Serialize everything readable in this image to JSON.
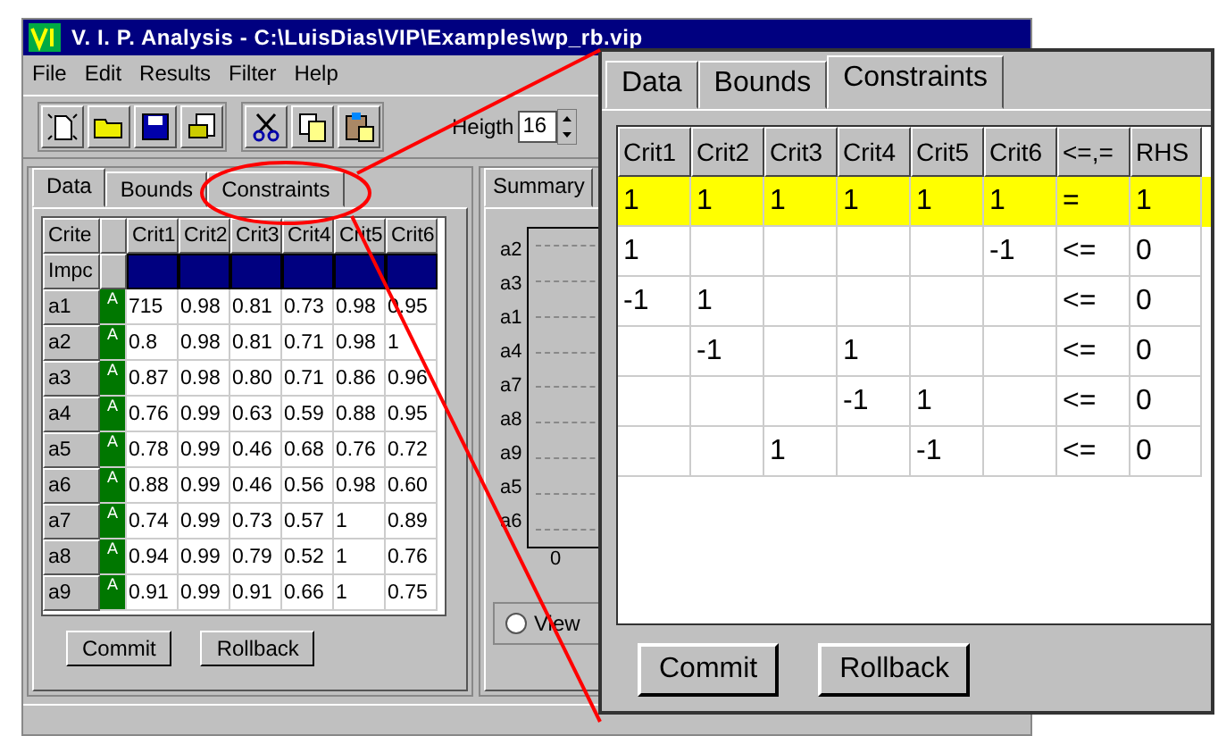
{
  "window": {
    "title": "V. I. P.  Analysis - C:\\LuisDias\\VIP\\Examples\\wp_rb.vip"
  },
  "menu": [
    "File",
    "Edit",
    "Results",
    "Filter",
    "Help"
  ],
  "toolbar": {
    "height_label": "Heigth",
    "height_value": "16"
  },
  "data_panel": {
    "tabs": [
      {
        "label": "Data",
        "selected": true
      },
      {
        "label": "Bounds",
        "selected": false
      },
      {
        "label": "Constraints",
        "selected": false
      }
    ],
    "corner": "Crite",
    "weights_label": "Impc",
    "columns": [
      "Crit1",
      "Crit2",
      "Crit3",
      "Crit4",
      "Crit5",
      "Crit6"
    ],
    "rows": [
      {
        "name": "a1",
        "flag": "A",
        "values": [
          "715",
          "0.98",
          "0.81",
          "0.73",
          "0.98",
          "0.95"
        ]
      },
      {
        "name": "a2",
        "flag": "A",
        "values": [
          "0.8",
          "0.98",
          "0.81",
          "0.71",
          "0.98",
          "1"
        ]
      },
      {
        "name": "a3",
        "flag": "A",
        "values": [
          "0.87",
          "0.98",
          "0.80",
          "0.71",
          "0.86",
          "0.96"
        ]
      },
      {
        "name": "a4",
        "flag": "A",
        "values": [
          "0.76",
          "0.99",
          "0.63",
          "0.59",
          "0.88",
          "0.95"
        ]
      },
      {
        "name": "a5",
        "flag": "A",
        "values": [
          "0.78",
          "0.99",
          "0.46",
          "0.68",
          "0.76",
          "0.72"
        ]
      },
      {
        "name": "a6",
        "flag": "A",
        "values": [
          "0.88",
          "0.99",
          "0.46",
          "0.56",
          "0.98",
          "0.60"
        ]
      },
      {
        "name": "a7",
        "flag": "A",
        "values": [
          "0.74",
          "0.99",
          "0.73",
          "0.57",
          "1",
          "0.89"
        ]
      },
      {
        "name": "a8",
        "flag": "A",
        "values": [
          "0.94",
          "0.99",
          "0.79",
          "0.52",
          "1",
          "0.76"
        ]
      },
      {
        "name": "a9",
        "flag": "A",
        "values": [
          "0.91",
          "0.99",
          "0.91",
          "0.66",
          "1",
          "0.75"
        ]
      }
    ],
    "buttons": [
      "Commit",
      "Rollback"
    ]
  },
  "summary_panel": {
    "tab": "Summary",
    "labels": [
      "a2",
      "a3",
      "a1",
      "a4",
      "a7",
      "a8",
      "a9",
      "a5",
      "a6"
    ],
    "axis_tick": "0",
    "radio": {
      "label": "View",
      "selected": false
    }
  },
  "zoom_inset": {
    "tabs": [
      {
        "label": "Data",
        "selected": false
      },
      {
        "label": "Bounds",
        "selected": false
      },
      {
        "label": "Constraints",
        "selected": true
      }
    ],
    "columns": [
      "Crit1",
      "Crit2",
      "Crit3",
      "Crit4",
      "Crit5",
      "Crit6",
      "<=,=",
      "RHS"
    ],
    "rows": [
      {
        "selected": true,
        "cells": [
          "1",
          "1",
          "1",
          "1",
          "1",
          "1",
          "=",
          "1"
        ]
      },
      {
        "selected": false,
        "cells": [
          "1",
          null,
          null,
          null,
          null,
          "-1",
          "<=",
          "0"
        ]
      },
      {
        "selected": false,
        "cells": [
          "-1",
          "1",
          null,
          null,
          null,
          null,
          "<=",
          "0"
        ]
      },
      {
        "selected": false,
        "cells": [
          null,
          "-1",
          null,
          "1",
          null,
          null,
          "<=",
          "0"
        ]
      },
      {
        "selected": false,
        "cells": [
          null,
          null,
          null,
          "-1",
          "1",
          null,
          "<=",
          "0"
        ]
      },
      {
        "selected": false,
        "cells": [
          null,
          null,
          "1",
          null,
          "-1",
          null,
          "<=",
          "0"
        ]
      }
    ],
    "buttons": [
      "Commit",
      "Rollback"
    ]
  }
}
